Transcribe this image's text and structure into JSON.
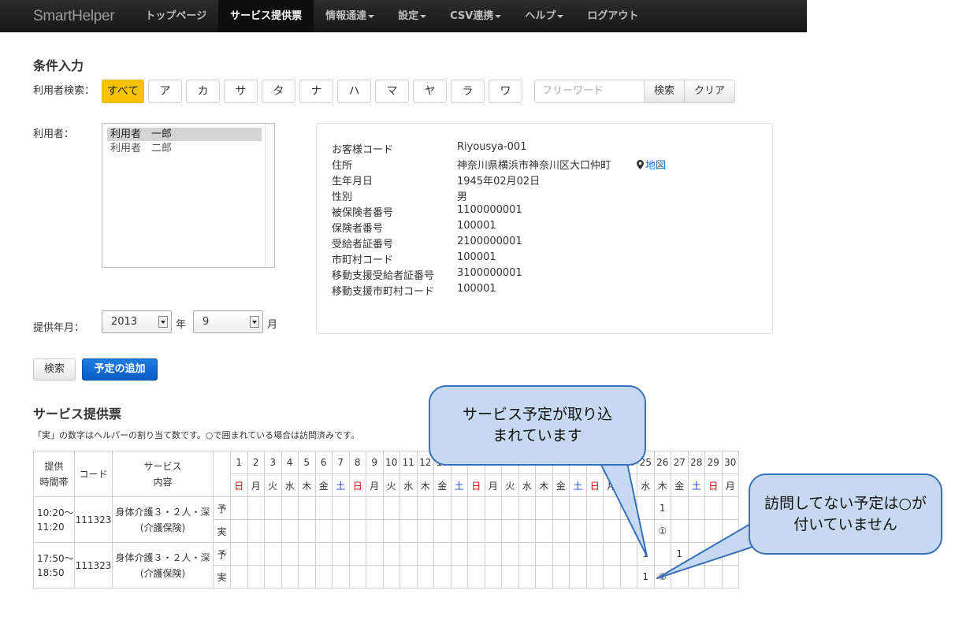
{
  "nav": {
    "brand": "SmartHelper",
    "items": [
      {
        "label": "トップページ",
        "active": false,
        "caret": false
      },
      {
        "label": "サービス提供票",
        "active": true,
        "caret": false
      },
      {
        "label": "情報通達",
        "active": false,
        "caret": true
      },
      {
        "label": "設定",
        "active": false,
        "caret": true
      },
      {
        "label": "CSV連携",
        "active": false,
        "caret": true
      },
      {
        "label": "ヘルプ",
        "active": false,
        "caret": true
      },
      {
        "label": "ログアウト",
        "active": false,
        "caret": false
      }
    ]
  },
  "conditions": {
    "title": "条件入力",
    "user_search_label": "利用者検索：",
    "kana_buttons": [
      "すべて",
      "ア",
      "カ",
      "サ",
      "タ",
      "ナ",
      "ハ",
      "マ",
      "ヤ",
      "ラ",
      "ワ"
    ],
    "freeword_placeholder": "フリーワード",
    "search_label": "検索",
    "clear_label": "クリア",
    "user_label": "利用者：",
    "users": [
      {
        "name": "利用者　一郎",
        "selected": true
      },
      {
        "name": "利用者　二郎",
        "selected": false
      }
    ],
    "period_label": "提供年月：",
    "year_value": "2013",
    "year_unit": "年",
    "month_value": "9",
    "month_unit": "月"
  },
  "info": {
    "rows": [
      {
        "key": "お客様コード",
        "value": "Riyousya-001"
      },
      {
        "key": "住所",
        "value": "神奈川県横浜市神奈川区大口仲町"
      },
      {
        "key": "生年月日",
        "value": "1945年02月02日"
      },
      {
        "key": "性別",
        "value": "男"
      },
      {
        "key": "被保険者番号",
        "value": "1100000001"
      },
      {
        "key": "保険者番号",
        "value": "100001"
      },
      {
        "key": "受給者証番号",
        "value": "2100000001"
      },
      {
        "key": "市町村コード",
        "value": "100001"
      },
      {
        "key": "移動支援受給者証番号",
        "value": "3100000001"
      },
      {
        "key": "移動支援市町村コード",
        "value": "100001"
      }
    ],
    "map_label": "地図"
  },
  "actions": {
    "search_label": "検索",
    "add_label": "予定の追加"
  },
  "schedule": {
    "title": "サービス提供票",
    "note": "「実」の数字はヘルパーの割り当て数です。○で囲まれている場合は訪問済みです。",
    "header_time": "提供時間帯",
    "header_code": "コード",
    "header_service": "サービス内容",
    "weekdays": [
      "日",
      "月",
      "火",
      "水",
      "木",
      "金",
      "土",
      "日",
      "月",
      "火",
      "水",
      "木",
      "金",
      "土",
      "日",
      "月",
      "火",
      "水",
      "木",
      "金",
      "土",
      "日",
      "月",
      "火",
      "水",
      "木",
      "金",
      "土",
      "日",
      "月"
    ],
    "rows": [
      {
        "time": "10:20〜11:20",
        "code": "111323",
        "service_line1": "身体介護３・２人・深",
        "service_line2": "(介護保険)",
        "plan_label": "予",
        "actual_label": "実",
        "plan_marks": [
          {
            "day": 26,
            "text": "1"
          }
        ],
        "actual_marks": [
          {
            "day": 26,
            "text": "①"
          }
        ]
      },
      {
        "time": "17:50〜18:50",
        "code": "111323",
        "service_line1": "身体介護３・２人・深",
        "service_line2": "(介護保険)",
        "plan_label": "予",
        "actual_label": "実",
        "plan_marks": [
          {
            "day": 25,
            "text": "1"
          },
          {
            "day": 27,
            "text": "1"
          }
        ],
        "actual_marks": [
          {
            "day": 25,
            "text": "1"
          },
          {
            "day": 26,
            "text": "①"
          }
        ]
      }
    ]
  },
  "callouts": {
    "service_imported": "サービス予定が取り込まれています",
    "not_visited": "訪問してない予定は○が付いていません"
  },
  "colors": {
    "navbar_bg": "#1b1b1b",
    "kana_active": "#f7c300",
    "primary_button": "#0b5bc4",
    "sunday": "#d00000",
    "saturday": "#1a3fd1",
    "callout_fill": "#c6d9f1",
    "callout_border": "#3a70b8",
    "link": "#1a6fc4"
  }
}
